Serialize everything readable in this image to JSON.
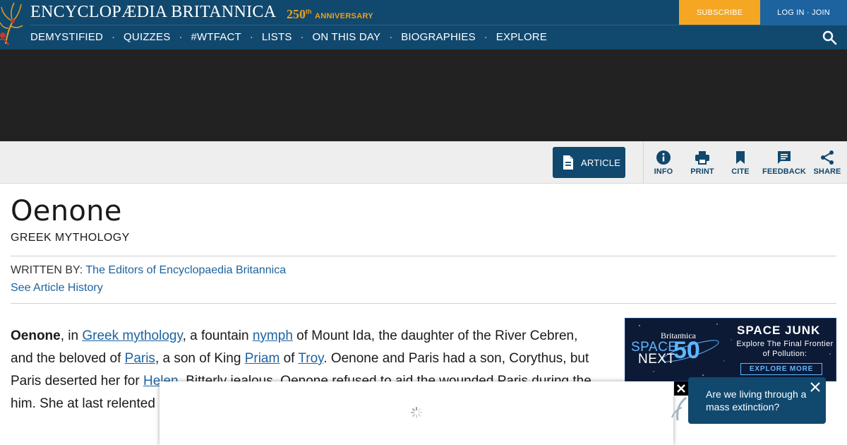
{
  "header": {
    "brand_title": "ENCYCLOPÆDIA BRITANNICA",
    "anniversary_number": "250",
    "anniversary_suffix": "th",
    "anniversary_word": "ANNIVERSARY",
    "subscribe_label": "SUBSCRIBE",
    "login_label": "LOG IN · JOIN",
    "nav": [
      "DEMYSTIFIED",
      "QUIZZES",
      "#WTFACT",
      "LISTS",
      "ON THIS DAY",
      "BIOGRAPHIES",
      "EXPLORE"
    ],
    "nav_separator": "·",
    "icons": {
      "search": "search-icon",
      "logo": "thistle-logo-icon"
    }
  },
  "toolbar": {
    "article_label": "ARTICLE",
    "tools": [
      {
        "label": "INFO",
        "icon": "info-icon"
      },
      {
        "label": "PRINT",
        "icon": "print-icon"
      },
      {
        "label": "CITE",
        "icon": "bookmark-icon"
      },
      {
        "label": "FEEDBACK",
        "icon": "feedback-icon"
      },
      {
        "label": "SHARE",
        "icon": "share-icon"
      }
    ]
  },
  "article": {
    "title": "Oenone",
    "topic": "GREEK MYTHOLOGY",
    "written_by_label": "WRITTEN BY:",
    "author": "The Editors of Encyclopaedia Britannica",
    "history_link": "See Article History",
    "body": {
      "lead": "Oenone",
      "t1": ", in ",
      "l1": "Greek mythology",
      "t2": ", a fountain ",
      "l2": "nymph",
      "t3": " of Mount Ida, the daughter of the River Cebren, and the beloved of ",
      "l3": "Paris",
      "t4": ", a son of King ",
      "l4": "Priam",
      "t5": " of ",
      "l5": "Troy",
      "t6": ". Oenone and Paris had a son, Corythus, but Paris deserted her for ",
      "l6": "Helen",
      "t7": ". Bitterly jealous, Oenone refused to aid the wounded Paris during the",
      "t8": "him. She at last relented"
    }
  },
  "side_ad": {
    "brand": "Britannica",
    "space": "SPACE",
    "next": "NEXT",
    "fifty": "50",
    "headline": "SPACE JUNK",
    "subline": "Explore The Final Frontier of Pollution:",
    "cta": "EXPLORE MORE"
  },
  "popup": {
    "text": "Are we living through a mass extinction?"
  },
  "colors": {
    "brand_navy": "#11486e",
    "subscribe_orange": "#f5a623",
    "login_blue": "#1c63a0",
    "link_blue": "#1c63a0",
    "anniversary_gold": "#e8a020"
  }
}
